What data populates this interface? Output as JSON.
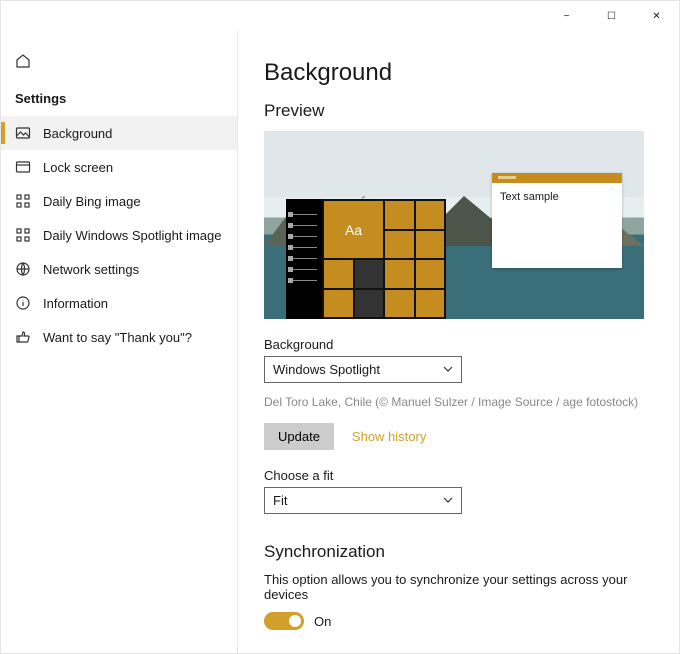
{
  "titlebar": {
    "minimize": "−",
    "maximize": "☐",
    "close": "✕"
  },
  "sidebar": {
    "settings_label": "Settings",
    "items": [
      {
        "icon": "image-icon",
        "label": "Background"
      },
      {
        "icon": "lock-icon",
        "label": "Lock screen"
      },
      {
        "icon": "apps-icon",
        "label": "Daily Bing image"
      },
      {
        "icon": "apps-icon",
        "label": "Daily Windows Spotlight image"
      },
      {
        "icon": "globe-icon",
        "label": "Network settings"
      },
      {
        "icon": "info-icon",
        "label": "Information"
      },
      {
        "icon": "thumbs-up-icon",
        "label": "Want to say \"Thank you\"?"
      }
    ]
  },
  "main": {
    "title": "Background",
    "preview_label": "Preview",
    "sample_text": "Text sample",
    "tile_text": "Aa",
    "background_label": "Background",
    "background_value": "Windows Spotlight",
    "attribution": "Del Toro Lake, Chile (© Manuel Sulzer / Image Source / age fotostock)",
    "update_btn": "Update",
    "history_link": "Show history",
    "fit_label": "Choose a fit",
    "fit_value": "Fit",
    "sync_title": "Synchronization",
    "sync_desc": "This option allows you to synchronize your settings across your devices",
    "toggle_label": "On"
  }
}
